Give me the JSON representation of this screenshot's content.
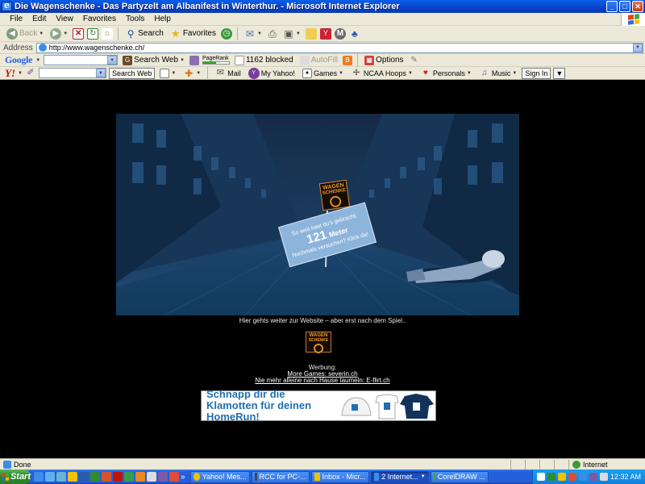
{
  "window": {
    "title": "Die Wagenschenke - Das Partyzelt am Albanifest in Winterthur. - Microsoft Internet Explorer",
    "minimize": "_",
    "maximize": "□",
    "close": "✕"
  },
  "menu": {
    "items": [
      "File",
      "Edit",
      "View",
      "Favorites",
      "Tools",
      "Help"
    ]
  },
  "toolbar": {
    "back_label": "Back",
    "search_label": "Search",
    "favorites_label": "Favorites"
  },
  "address": {
    "label": "Address",
    "url": "http://www.wagenschenke.ch/"
  },
  "google_toolbar": {
    "brand": "Google",
    "search_web_label": "Search Web",
    "pagerank_label": "PageRank",
    "blocked_label": "1162 blocked",
    "autofill_label": "AutoFill",
    "options_label": "Options"
  },
  "yahoo_toolbar": {
    "brand": "Y!",
    "search_web_label": "Search Web",
    "items": [
      "Mail",
      "My Yahoo!",
      "Games",
      "NCAA Hoops",
      "Personals",
      "Music"
    ],
    "signin_label": "Sign In"
  },
  "page": {
    "game": {
      "logo_line1": "WAGEN",
      "logo_line2": "SCHENKE",
      "sign_line1": "So weit hast du's gebracht:",
      "sign_distance": "121",
      "sign_unit": "Meter",
      "sign_line3": "Nochmals versuchen? Klick da!"
    },
    "caption": "Hier gehts weiter zur Website – aber erst nach dem Spiel..",
    "ad_label": "Werbung:",
    "link_games": "More Games: severin.ch",
    "link_flirt": "Nie mehr alleine nach Hause taumeln: E-flirt.ch",
    "banner_text": "Schnapp dir die Klamotten für deinen HomeRun!"
  },
  "status": {
    "text": "Done",
    "zone": "Internet"
  },
  "taskbar": {
    "start_label": "Start",
    "overflow": "»",
    "tasks": [
      "Yahoo! Mes...",
      "RCC for PC-...",
      "Inbox - Micr...",
      "2 Internet...",
      "CorelDRAW ..."
    ],
    "clock": "12:32 AM"
  },
  "colors": {
    "xp_blue": "#245edb",
    "scene_blue": "#1c4670",
    "sign_blue": "#8db4db",
    "logo_orange": "#e0892a"
  }
}
